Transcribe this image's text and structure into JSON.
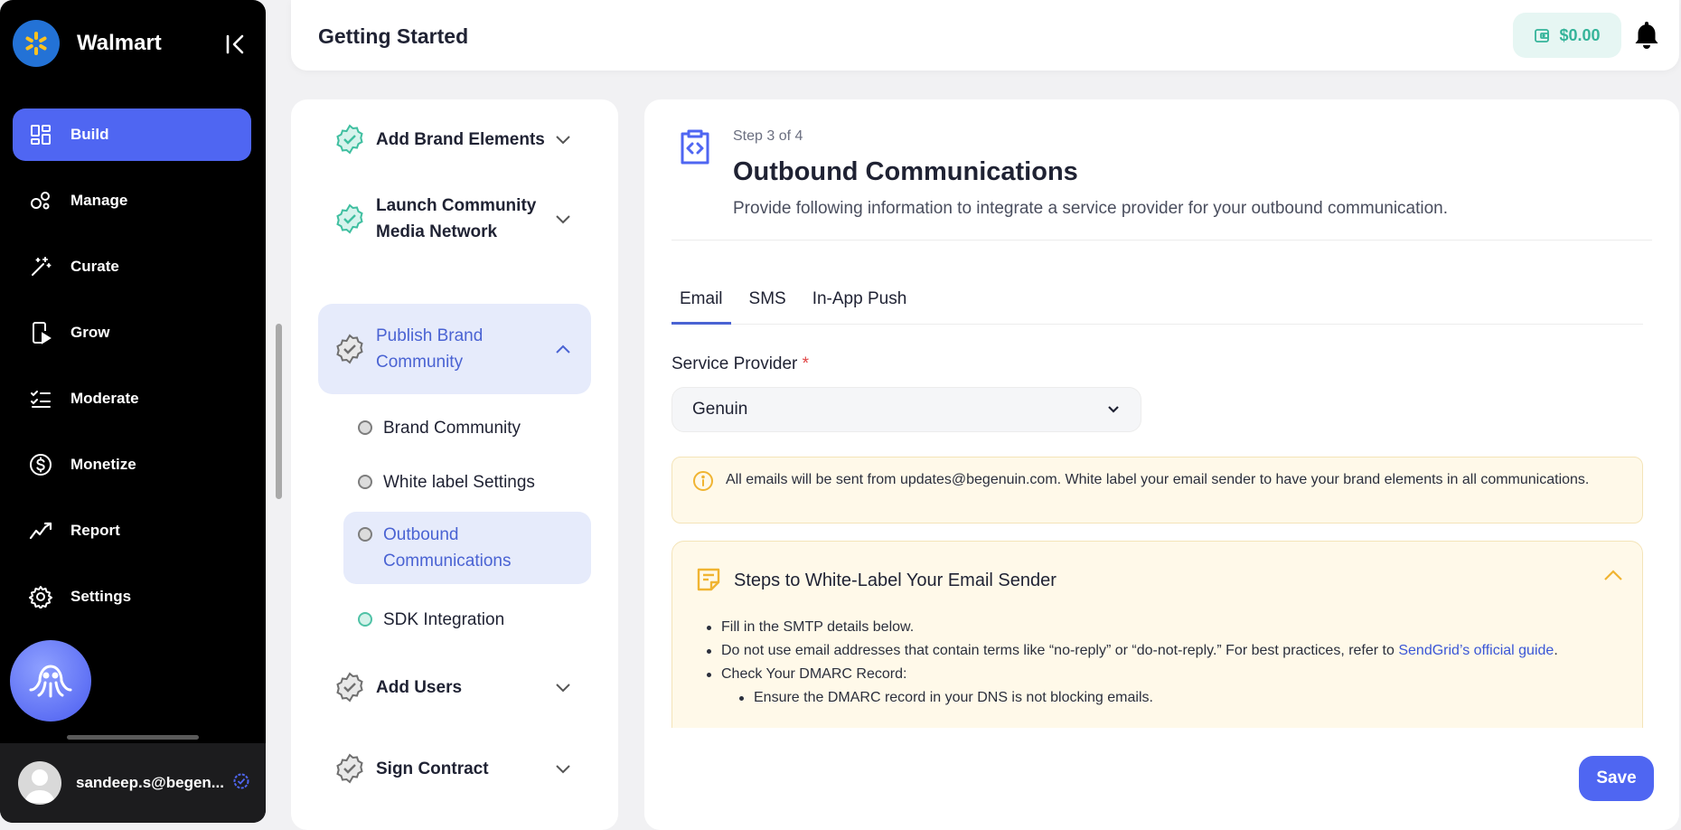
{
  "sidebar": {
    "brand_name": "Walmart",
    "items": [
      {
        "label": "Build",
        "icon": "dashboard-icon",
        "active": true
      },
      {
        "label": "Manage",
        "icon": "manage-icon"
      },
      {
        "label": "Curate",
        "icon": "magic-wand-icon"
      },
      {
        "label": "Grow",
        "icon": "phone-play-icon"
      },
      {
        "label": "Moderate",
        "icon": "checklist-icon"
      },
      {
        "label": "Monetize",
        "icon": "dollar-icon"
      },
      {
        "label": "Report",
        "icon": "trend-icon"
      },
      {
        "label": "Settings",
        "icon": "gear-icon"
      }
    ],
    "user_email": "sandeep.s@begen..."
  },
  "header": {
    "title": "Getting Started",
    "wallet_balance": "$0.00"
  },
  "steps": {
    "items": [
      {
        "label": "Add Brand Elements",
        "state": "complete"
      },
      {
        "label": "Launch Community Media Network",
        "state": "complete"
      },
      {
        "label": "Publish Brand Community",
        "state": "active"
      },
      {
        "label": "Add Users",
        "state": "pending"
      },
      {
        "label": "Sign Contract",
        "state": "pending"
      }
    ],
    "sub_items": [
      {
        "label": "Brand Community"
      },
      {
        "label": "White label Settings"
      },
      {
        "label": "Outbound Communications",
        "active": true
      },
      {
        "label": "SDK Integration"
      }
    ]
  },
  "main": {
    "step_of": "Step 3 of 4",
    "title": "Outbound Communications",
    "description": "Provide following information to integrate a service provider for your outbound communication.",
    "tabs": [
      "Email",
      "SMS",
      "In-App Push"
    ],
    "active_tab": "Email",
    "service_provider_label": "Service Provider",
    "required_mark": "*",
    "service_provider_value": "Genuin",
    "notice": "All emails will be sent from updates@begenuin.com. White label your email sender to have your brand elements in all communications.",
    "guide_title": "Steps to White-Label Your Email Sender",
    "guide_items": {
      "item1": "Fill in the SMTP details below.",
      "item2_text": "Do not use email addresses that contain terms like “no-reply” or “do-not-reply.” For best practices, refer to ",
      "item2_link": "SendGrid’s official guide",
      "item2_end": ".",
      "item3": "Check Your DMARC Record:",
      "item3_nested": "Ensure the DMARC record in your DNS is not blocking emails."
    },
    "save_label": "Save"
  },
  "colors": {
    "accent": "#4f66f2",
    "sidebar_bg": "#000000",
    "active_step_bg": "#e6ebfb",
    "complete_teal": "#3fbfa0",
    "notice_bg": "#fff9e9"
  }
}
